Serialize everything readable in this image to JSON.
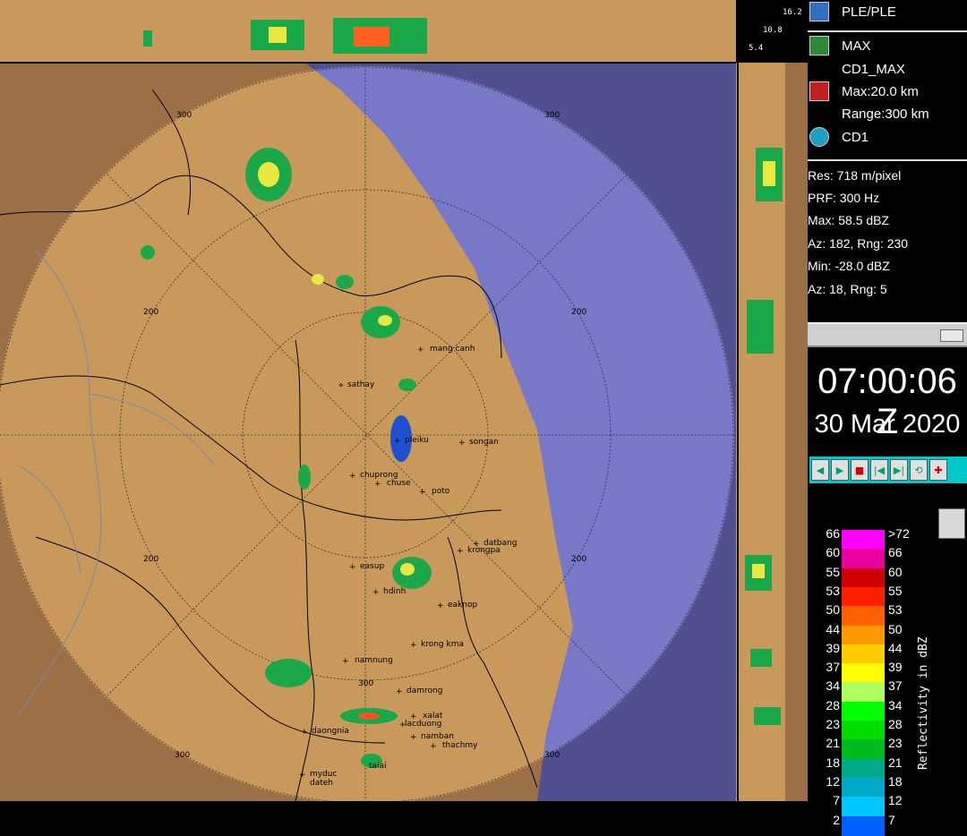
{
  "header": {
    "product_code": "PLE/PLE"
  },
  "scale_labels": [
    "16.2",
    "10.8",
    "5.4"
  ],
  "products": [
    {
      "icon": "max-product-icon",
      "label": "MAX"
    },
    {
      "icon": "",
      "label": "CD1_MAX"
    },
    {
      "icon": "heart-pulse-icon",
      "label": "Max:20.0 km"
    },
    {
      "icon": "",
      "label": "Range:300 km"
    },
    {
      "icon": "clock-icon",
      "label": "CD1"
    }
  ],
  "info": [
    "Res: 718 m/pixel",
    "PRF: 300 Hz",
    "Max: 58.5 dBZ",
    "Az: 182, Rng: 230",
    "Min: -28.0 dBZ",
    "Az:  18, Rng: 5"
  ],
  "time": "07:00:06 Z",
  "date": "30 Mar 2020",
  "legend": {
    "title": "Reflectivity in dBZ",
    "left_labels": [
      "66",
      "60",
      "55",
      "53",
      "50",
      "44",
      "39",
      "37",
      "34",
      "28",
      "23",
      "21",
      "18",
      "12",
      "7",
      "2"
    ],
    "right_labels": [
      ">72",
      "66",
      "60",
      "55",
      "53",
      "50",
      "44",
      "39",
      "37",
      "34",
      "28",
      "23",
      "21",
      "18",
      "12",
      "7"
    ],
    "colors": [
      "#ff00ff",
      "#e800a0",
      "#d00000",
      "#ff2000",
      "#ff6000",
      "#ff9900",
      "#ffcc00",
      "#ffff00",
      "#b0ff60",
      "#00ff00",
      "#00dd00",
      "#00bb20",
      "#00aa88",
      "#00a8c8",
      "#00c8ff",
      "#0060ff"
    ]
  },
  "map": {
    "range_labels": [
      "300",
      "200",
      "200",
      "300",
      "200",
      "200",
      "300",
      "300",
      "300"
    ],
    "places": [
      {
        "name": "mang canh"
      },
      {
        "name": "sathay"
      },
      {
        "name": "pleiku"
      },
      {
        "name": "songan"
      },
      {
        "name": "chuprong"
      },
      {
        "name": "chuse"
      },
      {
        "name": "poto"
      },
      {
        "name": "datbang"
      },
      {
        "name": "krongpa"
      },
      {
        "name": "easup"
      },
      {
        "name": "hdinh"
      },
      {
        "name": "eaknop"
      },
      {
        "name": "krong kma"
      },
      {
        "name": "namnung"
      },
      {
        "name": "damrong"
      },
      {
        "name": "xalat"
      },
      {
        "name": "lacduong"
      },
      {
        "name": "daongnia"
      },
      {
        "name": "namban"
      },
      {
        "name": "thachmy"
      },
      {
        "name": "myduc"
      },
      {
        "name": "dateh"
      },
      {
        "name": "taiai"
      }
    ]
  },
  "colors": {
    "land": "#c9995c",
    "land_outside": "#9c7047",
    "sea_inside": "#7878c8",
    "sea_outside": "#505090"
  }
}
